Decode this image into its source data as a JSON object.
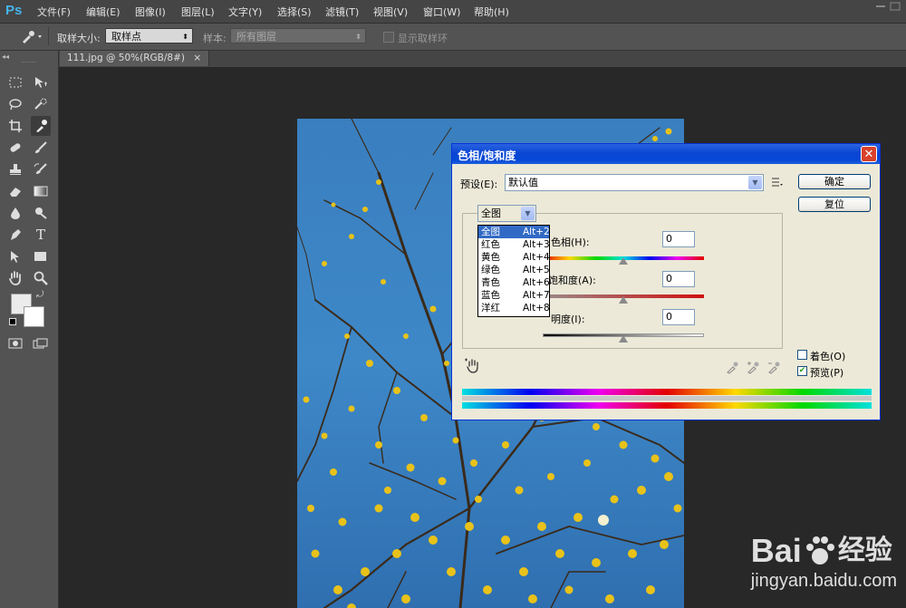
{
  "app": {
    "logo": "Ps"
  },
  "menubar": {
    "items": [
      {
        "label": "文件(F)"
      },
      {
        "label": "编辑(E)"
      },
      {
        "label": "图像(I)"
      },
      {
        "label": "图层(L)"
      },
      {
        "label": "文字(Y)"
      },
      {
        "label": "选择(S)"
      },
      {
        "label": "滤镜(T)"
      },
      {
        "label": "视图(V)"
      },
      {
        "label": "窗口(W)"
      },
      {
        "label": "帮助(H)"
      }
    ]
  },
  "options": {
    "sample_size_label": "取样大小:",
    "sample_size_value": "取样点",
    "sample_label": "样本:",
    "sample_value": "所有图层",
    "show_ring_label": "显示取样环"
  },
  "document": {
    "tab_title": "111.jpg @ 50%(RGB/8#)",
    "close_glyph": "×"
  },
  "dialog": {
    "title": "色相/饱和度",
    "close_glyph": "✕",
    "preset_label": "预设(E):",
    "preset_value": "默认值",
    "ok_label": "确定",
    "reset_label": "复位",
    "channel_value": "全图",
    "hue_label": "色相(H):",
    "hue_value": "0",
    "saturation_label": "饱和度(A):",
    "saturation_value": "0",
    "lightness_label": "明度(I):",
    "lightness_value": "0",
    "colorize_label": "着色(O)",
    "colorize_checked": false,
    "preview_label": "预览(P)",
    "preview_checked": true,
    "check_glyph": "✔"
  },
  "channel_menu": {
    "items": [
      {
        "label": "全图",
        "shortcut": "Alt+2",
        "selected": true
      },
      {
        "label": "红色",
        "shortcut": "Alt+3"
      },
      {
        "label": "黄色",
        "shortcut": "Alt+4"
      },
      {
        "label": "绿色",
        "shortcut": "Alt+5"
      },
      {
        "label": "青色",
        "shortcut": "Alt+6"
      },
      {
        "label": "蓝色",
        "shortcut": "Alt+7"
      },
      {
        "label": "洋红",
        "shortcut": "Alt+8"
      }
    ]
  },
  "watermark": {
    "brand": "Bai",
    "brand2": "经验",
    "url": "jingyan.baidu.com"
  },
  "colors": {
    "accent": "#46b3ea",
    "xp_title": "#0a46d4",
    "selection": "#316ac5",
    "sky": "#3b86c6"
  }
}
